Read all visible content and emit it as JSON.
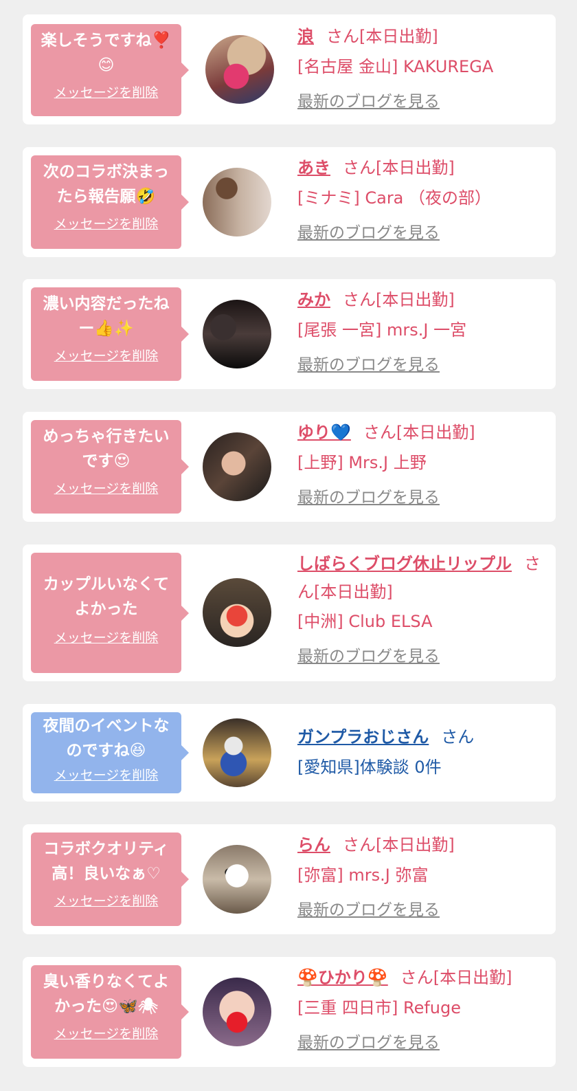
{
  "colors": {
    "pink_text": "#dd4d68",
    "blue_text": "#1f5aa6",
    "bubble_pink": "#eb98a5",
    "bubble_blue": "#92b4ec"
  },
  "delete_label": "メッセージを削除",
  "blog_label": "最新のブログを見る",
  "items": [
    {
      "message": "楽しそうですね❣️😊",
      "name": "浪",
      "suffix": "さん[本日出勤]",
      "shop": "[名古屋 金山] KAKUREGA",
      "has_blog": true,
      "theme": "pink"
    },
    {
      "message": "次のコラボ決まったら報告願🤣",
      "name": "あき",
      "suffix": "さん[本日出勤]",
      "shop": "[ミナミ] Cara （夜の部）",
      "has_blog": true,
      "theme": "pink"
    },
    {
      "message": "濃い内容だったねー👍✨",
      "name": "みか",
      "suffix": "さん[本日出勤]",
      "shop": "[尾張 一宮] mrs.J 一宮",
      "has_blog": true,
      "theme": "pink"
    },
    {
      "message": "めっちゃ行きたいです😍",
      "name": "ゆり💙",
      "suffix": "さん[本日出勤]",
      "shop": "[上野] Mrs.J 上野",
      "has_blog": true,
      "theme": "pink"
    },
    {
      "message": "カップルいなくてよかった",
      "name": "しばらくブログ休止リップル",
      "suffix": "さん[本日出勤]",
      "shop": "[中洲] Club ELSA",
      "has_blog": true,
      "theme": "pink"
    },
    {
      "message": "夜間のイベントなのですね😆",
      "name": "ガンプラおじさん",
      "suffix": "さん",
      "shop": "[愛知県]体験談 0件",
      "has_blog": false,
      "theme": "blue"
    },
    {
      "message": "コラボクオリティ高！良いなぁ♡",
      "name": "らん",
      "suffix": "さん[本日出勤]",
      "shop": "[弥富] mrs.J 弥富",
      "has_blog": true,
      "theme": "pink"
    },
    {
      "message": "臭い香りなくてよかった😍🦋🕷",
      "name": "🍄ひかり🍄",
      "suffix": "さん[本日出勤]",
      "shop": "[三重 四日市] Refuge",
      "has_blog": true,
      "theme": "pink"
    }
  ]
}
